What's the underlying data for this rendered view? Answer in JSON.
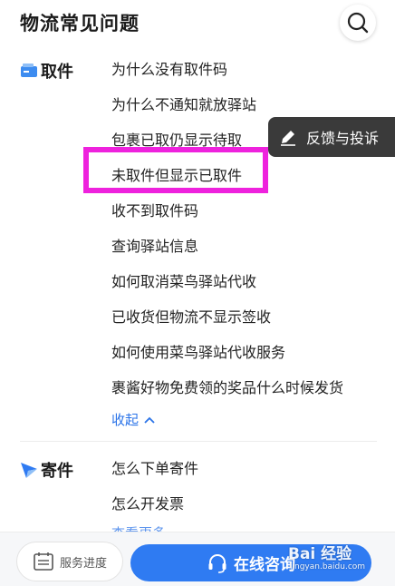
{
  "header": {
    "title": "物流常见问题",
    "search_icon": "search-icon"
  },
  "sections": {
    "pickup": {
      "title": "取件",
      "icon": "pickup-card-icon",
      "questions": [
        "为什么没有取件码",
        "为什么不通知就放驿站",
        "包裹已取仍显示待取",
        "未取件但显示已取件",
        "收不到取件码",
        "查询驿站信息",
        "如何取消菜鸟驿站代收",
        "已收货但物流不显示签收",
        "如何使用菜鸟驿站代收服务",
        "裹酱好物免费领的奖品什么时候发货"
      ],
      "collapse_label": "收起"
    },
    "send": {
      "title": "寄件",
      "icon": "send-plane-icon",
      "questions": [
        "怎么下单寄件",
        "怎么开发票"
      ],
      "more_label": "查看更多"
    }
  },
  "feedback": {
    "label": "反馈与投诉",
    "icon": "edit-pencil-icon"
  },
  "bottom_bar": {
    "progress_label": "服务进度",
    "consult_label": "在线咨询"
  },
  "watermark": {
    "logo": "Bai 经验",
    "url": "jingyan.baidu.com"
  },
  "colors": {
    "accent": "#2f7bf2",
    "link": "#2a73e8",
    "highlight": "#ee22dd",
    "feedback_bg": "#3a3a3a"
  }
}
